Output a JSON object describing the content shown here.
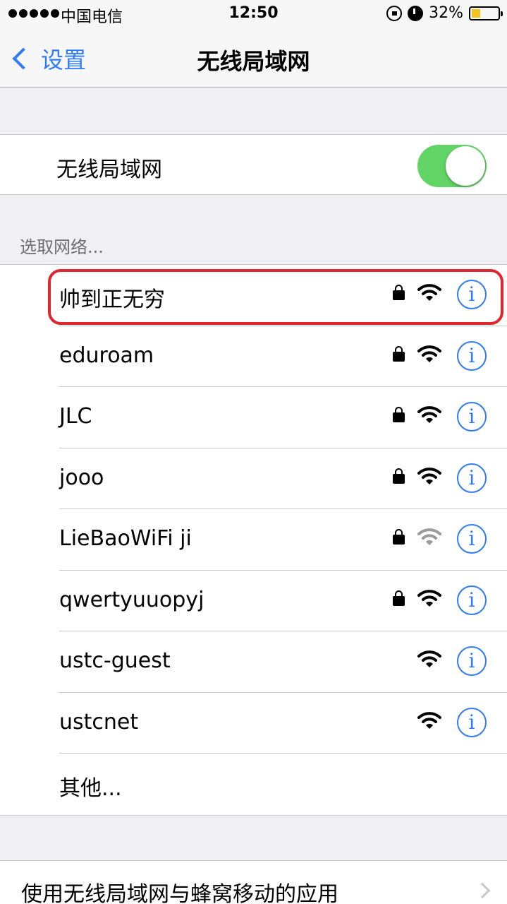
{
  "status_bar": {
    "carrier": "中国电信",
    "time": "12:50",
    "battery_percent": "32%",
    "signal_bars": 5,
    "icons": [
      "rotation-lock-icon",
      "alarm-icon",
      "battery-icon"
    ],
    "battery_color": "#f4c31e"
  },
  "nav": {
    "back_label": "设置",
    "title": "无线局域网"
  },
  "wifi_toggle": {
    "label": "无线局域网",
    "enabled": true,
    "on_color": "#62d465"
  },
  "section_header": "选取网络...",
  "networks": [
    {
      "name": "帅到正无穷",
      "secured": true,
      "signal": "strong",
      "highlighted": true
    },
    {
      "name": "eduroam",
      "secured": true,
      "signal": "strong"
    },
    {
      "name": "JLC",
      "secured": true,
      "signal": "strong"
    },
    {
      "name": "jooo",
      "secured": true,
      "signal": "strong"
    },
    {
      "name": "LieBaoWiFi ji",
      "secured": true,
      "signal": "weak"
    },
    {
      "name": "qwertyuuopyj",
      "secured": true,
      "signal": "strong"
    },
    {
      "name": "ustc-guest",
      "secured": false,
      "signal": "strong"
    },
    {
      "name": "ustcnet",
      "secured": false,
      "signal": "strong"
    }
  ],
  "other_label": "其他...",
  "info_glyph": "i",
  "bottom_item": "使用无线局域网与蜂窝移动的应用",
  "colors": {
    "accent": "#2f7cf6",
    "highlight": "#e0262f",
    "background": "#efeff4"
  }
}
